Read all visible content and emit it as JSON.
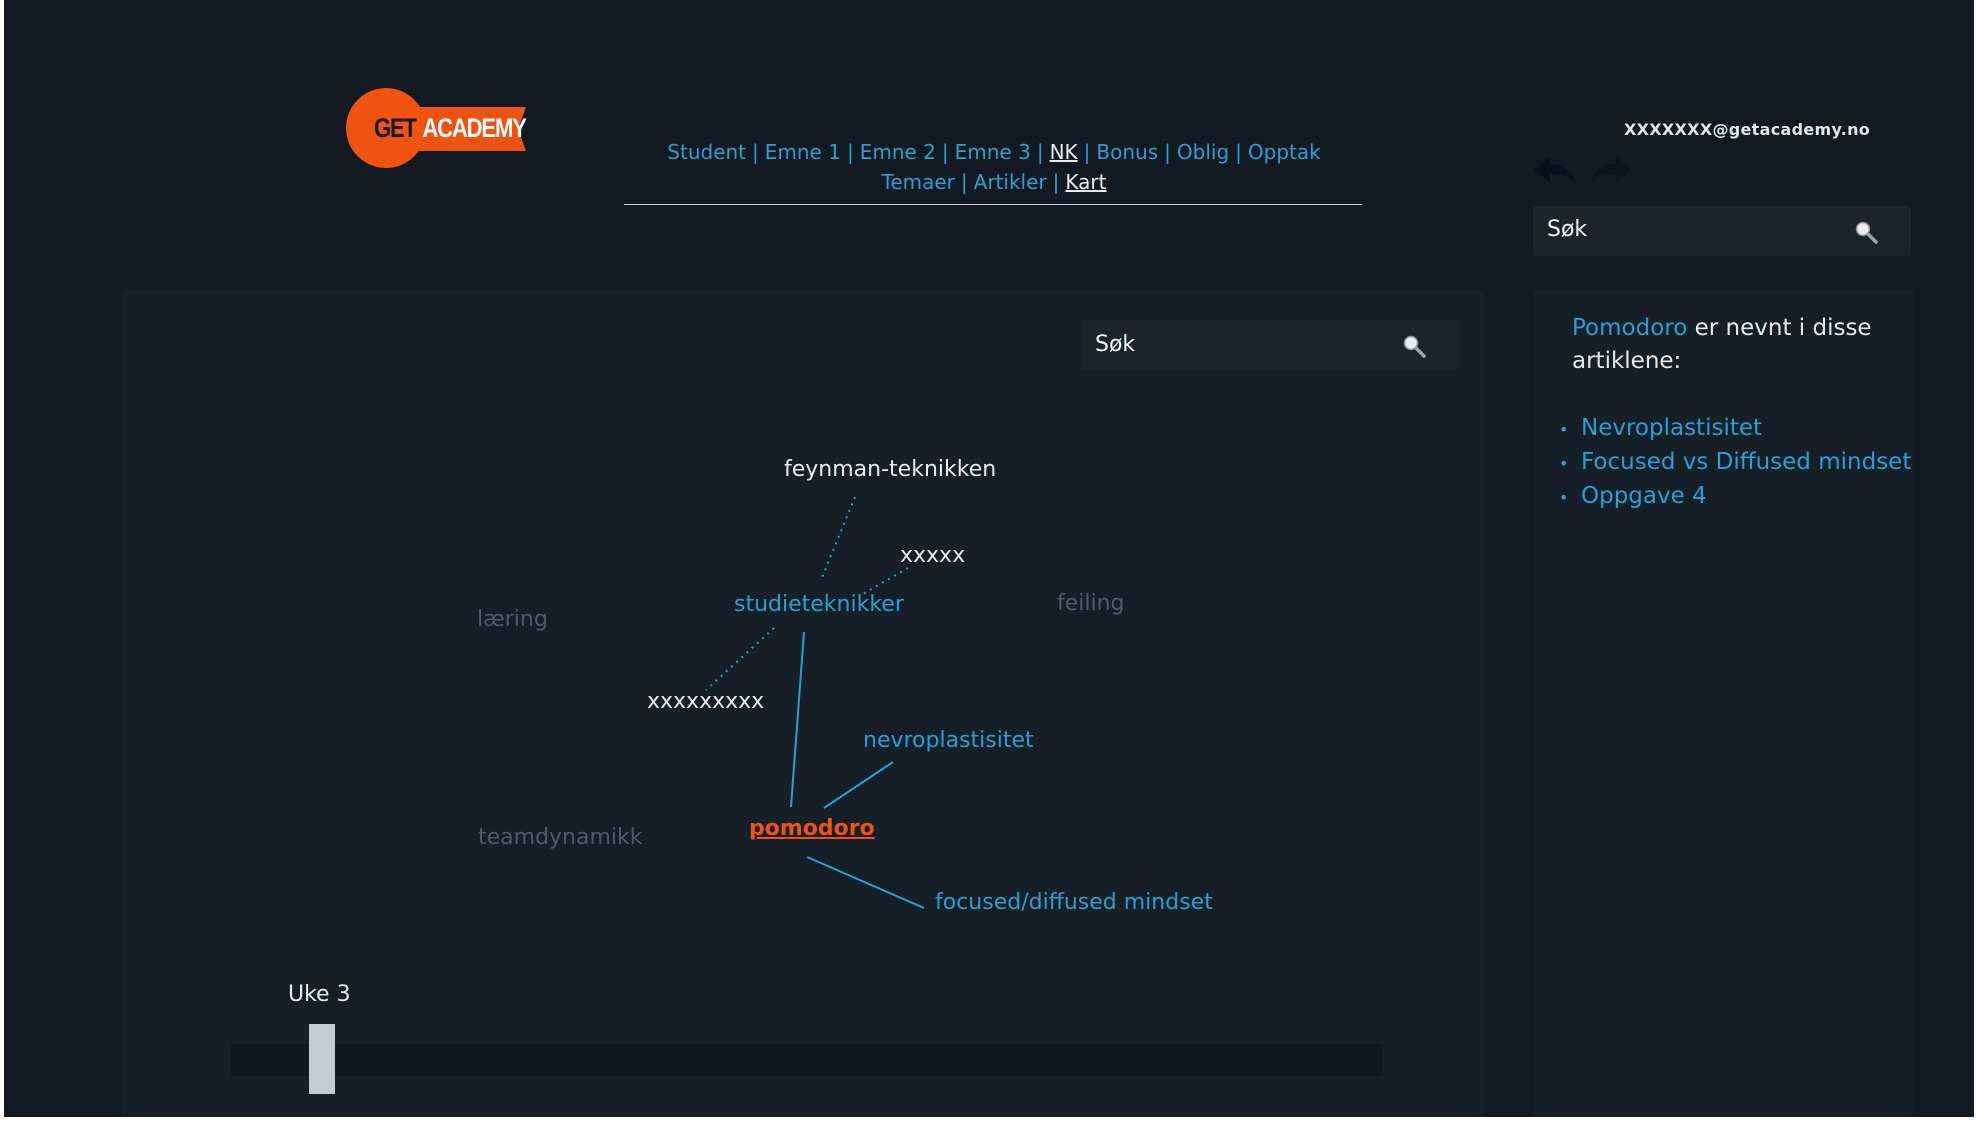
{
  "header": {
    "logo_text": {
      "get": "GET",
      "academy": "ACADEMY"
    },
    "user_email": "XXXXXXX@getacademy.no"
  },
  "nav": {
    "row1": [
      "Student",
      "Emne 1",
      "Emne 2",
      "Emne 3",
      "NK",
      "Bonus",
      "Oblig",
      "Opptak"
    ],
    "row2": [
      "Temaer",
      "Artikler",
      "Kart"
    ],
    "active": [
      "NK",
      "Kart"
    ]
  },
  "top_search": {
    "placeholder": "Søk"
  },
  "map": {
    "search_placeholder": "Søk",
    "nodes": {
      "feynman": "feynman-teknikken",
      "xxxxx": "xxxxx",
      "laering": "læring",
      "studieteknikker": "studieteknikker",
      "feiling": "feiling",
      "xxxxxxxxx": "xxxxxxxxx",
      "nevroplastisitet": "nevroplastisitet",
      "teamdynamikk": "teamdynamikk",
      "pomodoro": "pomodoro",
      "focused": "focused/diffused mindset"
    },
    "week_label": "Uke 3",
    "week_slider_position": 0.06
  },
  "side": {
    "keyword": "Pomodoro",
    "heading_rest": " er nevnt i disse artiklene:",
    "articles": [
      "Nevroplastisitet",
      "Focused vs Diffused mindset",
      "Oppgave 4"
    ]
  },
  "colors": {
    "background": "#111a22",
    "panel": "#141f28",
    "accent_blue": "#2a9fd0",
    "accent_orange": "#f0520f",
    "dim_text": "#4e5b66"
  },
  "icons": [
    "undo-arrow-icon",
    "redo-arrow-icon",
    "search-icon"
  ]
}
